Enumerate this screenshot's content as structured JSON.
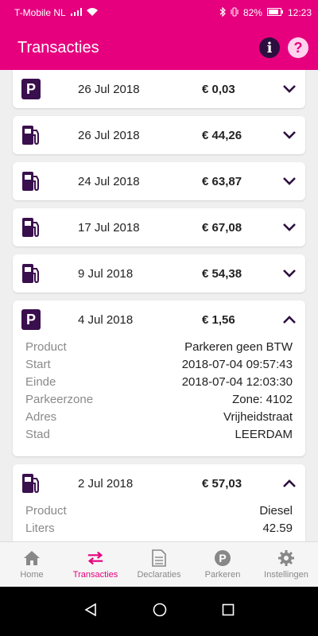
{
  "status_bar": {
    "carrier": "T-Mobile NL",
    "battery": "82%",
    "time": "12:23"
  },
  "header": {
    "title": "Transacties"
  },
  "transactions": [
    {
      "type": "parking",
      "date": "26 Jul 2018",
      "amount": "€ 0,03",
      "expanded": false
    },
    {
      "type": "fuel",
      "date": "26 Jul 2018",
      "amount": "€ 44,26",
      "expanded": false
    },
    {
      "type": "fuel",
      "date": "24 Jul 2018",
      "amount": "€ 63,87",
      "expanded": false
    },
    {
      "type": "fuel",
      "date": "17 Jul 2018",
      "amount": "€ 67,08",
      "expanded": false
    },
    {
      "type": "fuel",
      "date": "9 Jul 2018",
      "amount": "€ 54,38",
      "expanded": false
    },
    {
      "type": "parking",
      "date": "4 Jul 2018",
      "amount": "€ 1,56",
      "expanded": true,
      "details": [
        {
          "label": "Product",
          "value": "Parkeren geen BTW"
        },
        {
          "label": "Start",
          "value": "2018-07-04 09:57:43"
        },
        {
          "label": "Einde",
          "value": "2018-07-04 12:03:30"
        },
        {
          "label": "Parkeerzone",
          "value": "Zone: 4102"
        },
        {
          "label": "Adres",
          "value": "Vrijheidstraat"
        },
        {
          "label": "Stad",
          "value": "LEERDAM"
        }
      ]
    },
    {
      "type": "fuel",
      "date": "2 Jul 2018",
      "amount": "€ 57,03",
      "expanded": true,
      "details": [
        {
          "label": "Product",
          "value": "Diesel"
        },
        {
          "label": "Liters",
          "value": "42.59"
        }
      ]
    }
  ],
  "bottom_nav": [
    {
      "label": "Home",
      "icon": "home-icon",
      "active": false
    },
    {
      "label": "Transacties",
      "icon": "transfer-icon",
      "active": true
    },
    {
      "label": "Declaraties",
      "icon": "document-icon",
      "active": false
    },
    {
      "label": "Parkeren",
      "icon": "parking-icon",
      "active": false
    },
    {
      "label": "Instellingen",
      "icon": "gear-icon",
      "active": false
    }
  ],
  "colors": {
    "brand": "#e6007e",
    "dark_purple": "#3a0f4d"
  }
}
